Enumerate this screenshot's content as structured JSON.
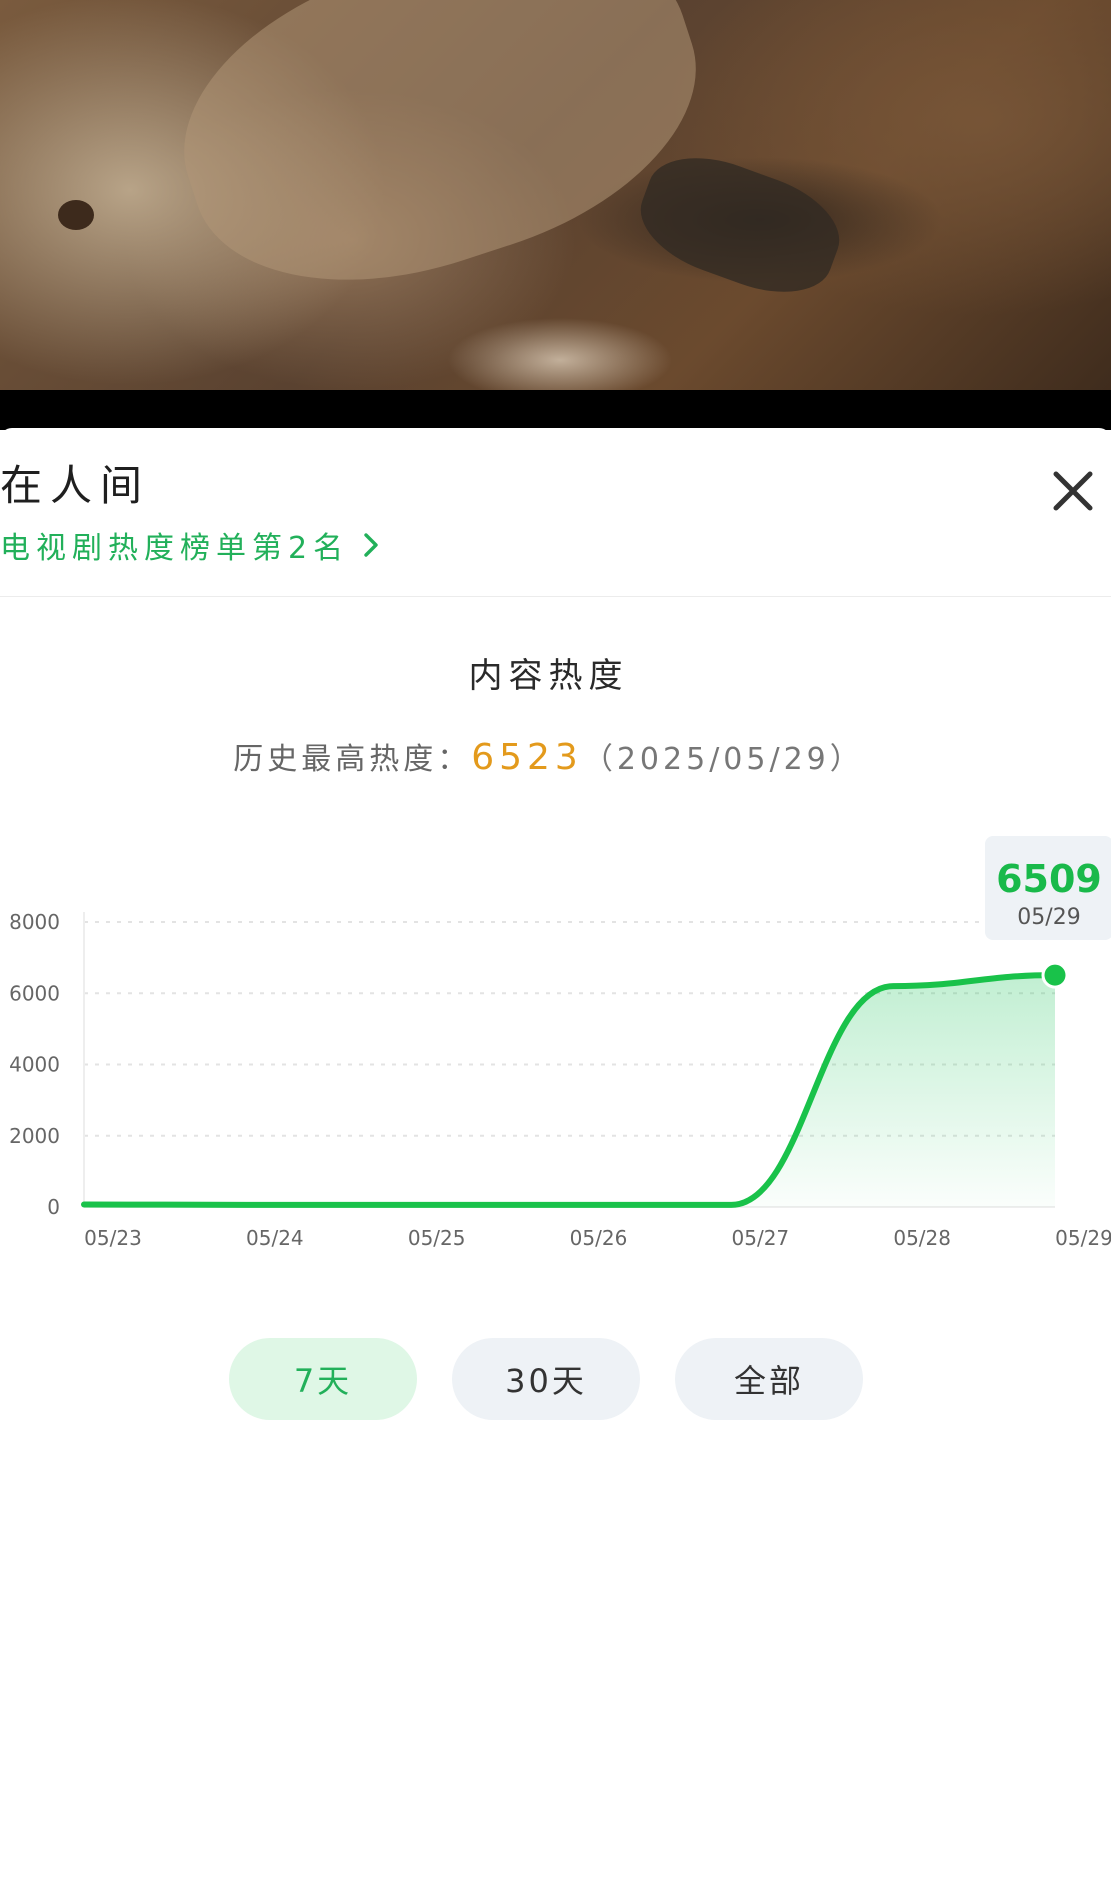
{
  "show": {
    "title": "在人间",
    "rank_text": "电视剧热度榜单第2名"
  },
  "section": {
    "title": "内容热度",
    "peak_label": "历史最高热度：",
    "peak_value": "6523",
    "peak_date": "（2025/05/29）"
  },
  "tooltip": {
    "value": "6509",
    "date": "05/29"
  },
  "tabs": [
    {
      "label": "7天",
      "active": true
    },
    {
      "label": "30天",
      "active": false
    },
    {
      "label": "全部",
      "active": false
    }
  ],
  "colors": {
    "accent_green": "#22b05a",
    "line_green": "#19c24a",
    "peak_orange": "#e39a1c",
    "tab_bg": "#eef2f6",
    "tab_active_bg": "#dff7e6"
  },
  "icons": {
    "close": "close-icon",
    "chevron": "chevron-right-icon"
  },
  "chart_data": {
    "type": "area",
    "title": "",
    "xlabel": "",
    "ylabel": "",
    "grid": true,
    "ylim": [
      0,
      8000
    ],
    "yticks": [
      "0",
      "2000",
      "4000",
      "6000",
      "8000"
    ],
    "x": [
      "05/23",
      "05/24",
      "05/25",
      "05/26",
      "05/27",
      "05/28",
      "05/29"
    ],
    "series": [
      {
        "values": [
          70,
          60,
          60,
          60,
          60,
          6200,
          6509
        ]
      }
    ]
  }
}
